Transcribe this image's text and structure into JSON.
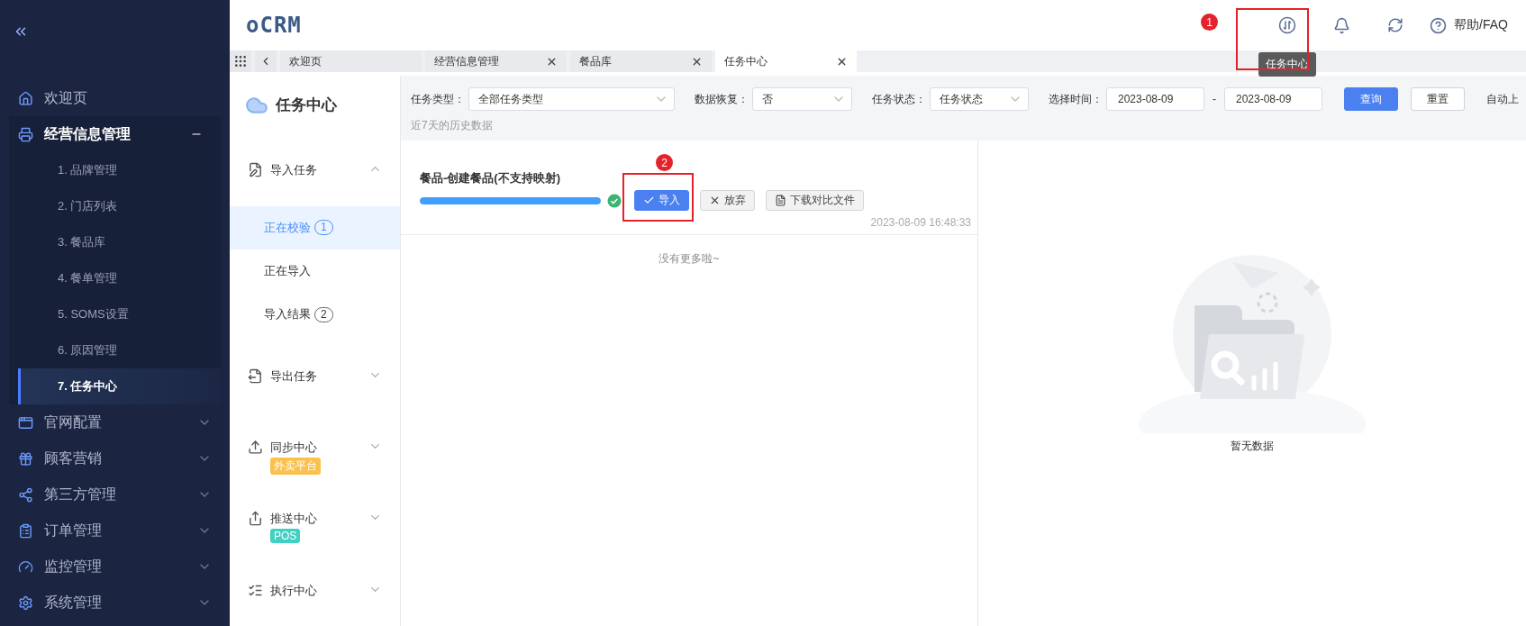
{
  "sidebar": {
    "items": [
      {
        "label": "欢迎页",
        "kind": "link"
      },
      {
        "label": "经营信息管理",
        "kind": "group",
        "expanded": true,
        "children": [
          {
            "label": "1. 品牌管理",
            "selected": false
          },
          {
            "label": "2. 门店列表",
            "selected": false
          },
          {
            "label": "3. 餐品库",
            "selected": false
          },
          {
            "label": "4. 餐单管理",
            "selected": false
          },
          {
            "label": "5. SOMS设置",
            "selected": false
          },
          {
            "label": "6. 原因管理",
            "selected": false
          },
          {
            "label": "7. 任务中心",
            "selected": true
          }
        ]
      },
      {
        "label": "官网配置",
        "kind": "group",
        "expanded": false
      },
      {
        "label": "顾客营销",
        "kind": "group",
        "expanded": false
      },
      {
        "label": "第三方管理",
        "kind": "group",
        "expanded": false
      },
      {
        "label": "订单管理",
        "kind": "group",
        "expanded": false
      },
      {
        "label": "监控管理",
        "kind": "group",
        "expanded": false
      },
      {
        "label": "系统管理",
        "kind": "group",
        "expanded": false
      }
    ]
  },
  "header": {
    "logo": "oCRM",
    "help": "帮助/FAQ",
    "tooltip": "任务中心"
  },
  "tabs": [
    {
      "label": "欢迎页",
      "closable": false,
      "selected": false
    },
    {
      "label": "经营信息管理",
      "closable": true,
      "selected": false
    },
    {
      "label": "餐品库",
      "closable": true,
      "selected": false
    },
    {
      "label": "任务中心",
      "closable": true,
      "selected": true
    }
  ],
  "task_nav": {
    "title": "任务中心",
    "groups": [
      {
        "label": "导入任务",
        "expanded": true,
        "children": [
          {
            "label": "正在校验",
            "count": "1",
            "selected": true
          },
          {
            "label": "正在导入",
            "selected": false
          },
          {
            "label": "导入结果",
            "count": "2",
            "selected": false
          }
        ]
      },
      {
        "label": "导出任务",
        "expanded": false
      },
      {
        "label": "同步中心",
        "expanded": false,
        "tag": "外卖平台",
        "color": "#fbc04e"
      },
      {
        "label": "推送中心",
        "expanded": false,
        "tag": "POS",
        "color": "#3ed1c4"
      },
      {
        "label": "执行中心",
        "expanded": false
      }
    ]
  },
  "filters": [
    {
      "kind": "select",
      "label": "任务类型：",
      "value": "全部任务类型"
    },
    {
      "kind": "select",
      "label": "数据恢复：",
      "value": "否"
    },
    {
      "kind": "select",
      "label": "任务状态：",
      "value": "任务状态"
    },
    {
      "kind": "daterange",
      "label": "选择时间：",
      "from": "2023-08-09",
      "separator": "-",
      "to": "2023-08-09"
    }
  ],
  "buttons": [
    {
      "label": "查询",
      "primary": true
    },
    {
      "label": "重置",
      "primary": false
    }
  ],
  "auto_upload": "自动上",
  "history_note": "近7天的历史数据",
  "tasks": [
    {
      "title": "餐品-创建餐品(不支持映射)",
      "level": 1,
      "done": true,
      "time": "2023-08-09 16:48:33",
      "actions": [
        {
          "label": "导入",
          "kind": "primary"
        },
        {
          "label": "放弃",
          "kind": "discard"
        },
        {
          "label": "下载对比文件",
          "kind": "download"
        }
      ]
    }
  ],
  "list_end": "没有更多啦~",
  "empty": {
    "text": "暂无数据"
  },
  "annotations": [
    {
      "label": "1"
    },
    {
      "label": "2"
    }
  ]
}
